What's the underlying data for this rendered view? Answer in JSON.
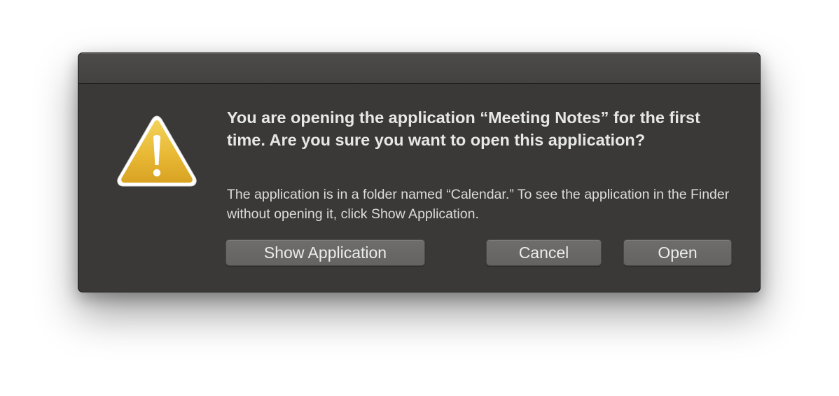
{
  "dialog": {
    "icon": "warning-icon",
    "message": "You are opening the application “Meeting Notes” for the first time. Are you sure you want to open this application?",
    "informative_text": "The application is in a folder named “Calendar.” To see the application in the Finder without opening it, click Show Application.",
    "buttons": {
      "show_application": "Show Application",
      "cancel": "Cancel",
      "open": "Open"
    }
  },
  "colors": {
    "dialog_background": "#3a3938",
    "button_background": "#686766",
    "warning_yellow": "#e6b834",
    "text": "#e7e7e7"
  }
}
